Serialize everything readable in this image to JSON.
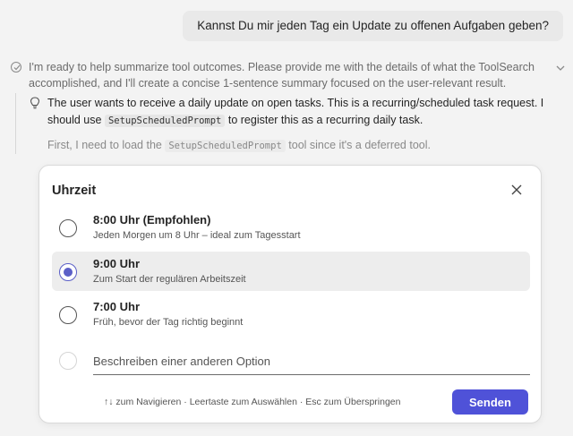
{
  "user_message": "Kannst Du mir jeden Tag ein Update zu offenen Aufgaben geben?",
  "assistant": {
    "thinking_text": "I'm ready to help summarize tool outcomes. Please provide me with the details of what the ToolSearch accomplished, and I'll create a concise 1-sentence summary focused on the user-relevant result.",
    "note_part1": "The user wants to receive a daily update on open tasks. This is a recurring/scheduled task request. I should use",
    "note_code": "SetupScheduledPrompt",
    "note_part2": "to register this as a recurring daily task.",
    "first_part1": "First, I need to load the",
    "first_code": "SetupScheduledPrompt",
    "first_part2": "tool since it's a deferred tool."
  },
  "dialog": {
    "title": "Uhrzeit",
    "options": [
      {
        "title": "8:00 Uhr (Empfohlen)",
        "description": "Jeden Morgen um 8 Uhr – ideal zum Tagesstart",
        "selected": false
      },
      {
        "title": "9:00 Uhr",
        "description": "Zum Start der regulären Arbeitszeit",
        "selected": true
      },
      {
        "title": "7:00 Uhr",
        "description": "Früh, bevor der Tag richtig beginnt",
        "selected": false
      }
    ],
    "other_placeholder": "Beschreiben einer anderen Option",
    "hint": "↑↓ zum Navigieren · Leertaste zum Auswählen · Esc zum Überspringen",
    "send_label": "Senden"
  },
  "colors": {
    "accent": "#5b5fc7",
    "send_button": "#4f52d8",
    "selected_row": "#ededed"
  },
  "icons": [
    "check-circle-icon",
    "chevron-down-icon",
    "lightbulb-icon",
    "close-icon"
  ]
}
